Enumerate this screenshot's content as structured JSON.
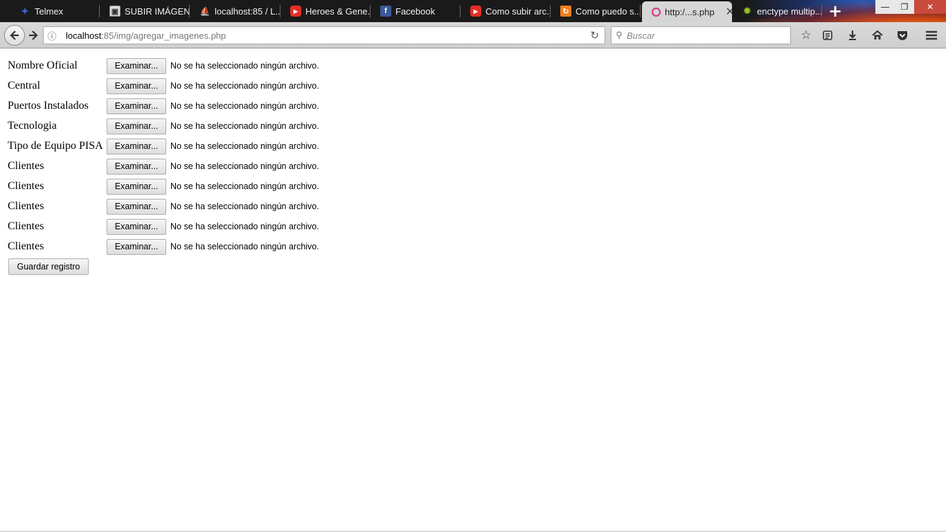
{
  "browser": {
    "tabs": [
      {
        "title": "Telmex",
        "icon": "telmex-icon",
        "active": false
      },
      {
        "title": "SUBIR IMÁGEN...",
        "icon": "image-icon",
        "active": false
      },
      {
        "title": "localhost:85 / L...",
        "icon": "phpmyadmin-icon",
        "active": false
      },
      {
        "title": "Heroes & Gene...",
        "icon": "youtube-icon",
        "active": false
      },
      {
        "title": "Facebook",
        "icon": "facebook-icon",
        "active": false
      },
      {
        "title": "Como subir arc...",
        "icon": "youtube-icon",
        "active": false
      },
      {
        "title": "Como puedo s...",
        "icon": "stackoverflow-icon",
        "active": false
      },
      {
        "title": "http:/...s.php",
        "icon": "http-icon",
        "active": true
      },
      {
        "title": "enctype multip...",
        "icon": "android-icon",
        "active": false
      }
    ],
    "url_host": "localhost",
    "url_path": ":85/img/agregar_imagenes.php",
    "search_placeholder": "Buscar",
    "accent": "#3b5998"
  },
  "form": {
    "rows": [
      {
        "label": "Nombre Oficial",
        "button": "Examinar...",
        "status": "No se ha seleccionado ningún archivo."
      },
      {
        "label": "Central",
        "button": "Examinar...",
        "status": "No se ha seleccionado ningún archivo."
      },
      {
        "label": "Puertos Instalados",
        "button": "Examinar...",
        "status": "No se ha seleccionado ningún archivo."
      },
      {
        "label": "Tecnologia",
        "button": "Examinar...",
        "status": "No se ha seleccionado ningún archivo."
      },
      {
        "label": "Tipo de Equipo PISA",
        "button": "Examinar...",
        "status": "No se ha seleccionado ningún archivo."
      },
      {
        "label": "Clientes",
        "button": "Examinar...",
        "status": "No se ha seleccionado ningún archivo."
      },
      {
        "label": "Clientes",
        "button": "Examinar...",
        "status": "No se ha seleccionado ningún archivo."
      },
      {
        "label": "Clientes",
        "button": "Examinar...",
        "status": "No se ha seleccionado ningún archivo."
      },
      {
        "label": "Clientes",
        "button": "Examinar...",
        "status": "No se ha seleccionado ningún archivo."
      },
      {
        "label": "Clientes",
        "button": "Examinar...",
        "status": "No se ha seleccionado ningún archivo."
      }
    ],
    "submit_label": "Guardar registro"
  }
}
